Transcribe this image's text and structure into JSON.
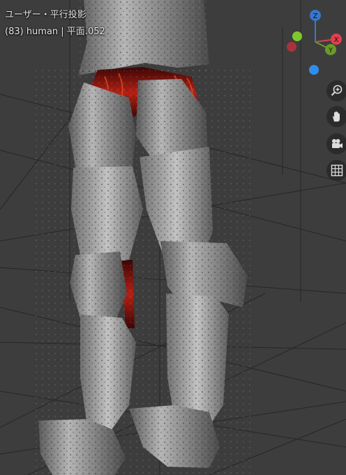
{
  "viewport": {
    "view_name": "ユーザー・平行投影",
    "object_info": "(83) human | 平面.052"
  },
  "gizmo": {
    "axes": [
      {
        "label": "Z",
        "color": "#3a76cc"
      },
      {
        "label": "X",
        "color": "#e0404f"
      },
      {
        "label": "Y",
        "color": "#6a9a2a"
      }
    ],
    "negative_colors": {
      "x": "#a8323d",
      "y": "#7ec82e",
      "z": "#2e8ef0"
    }
  },
  "tools": [
    {
      "name": "zoom",
      "icon": "magnifier-plus-icon"
    },
    {
      "name": "pan",
      "icon": "hand-icon"
    },
    {
      "name": "camera",
      "icon": "camera-icon"
    },
    {
      "name": "grid",
      "icon": "grid-icon"
    }
  ],
  "colors": {
    "background": "#3d3d3d",
    "armor": "#8a8a8a",
    "cloth": "#8c1410"
  }
}
